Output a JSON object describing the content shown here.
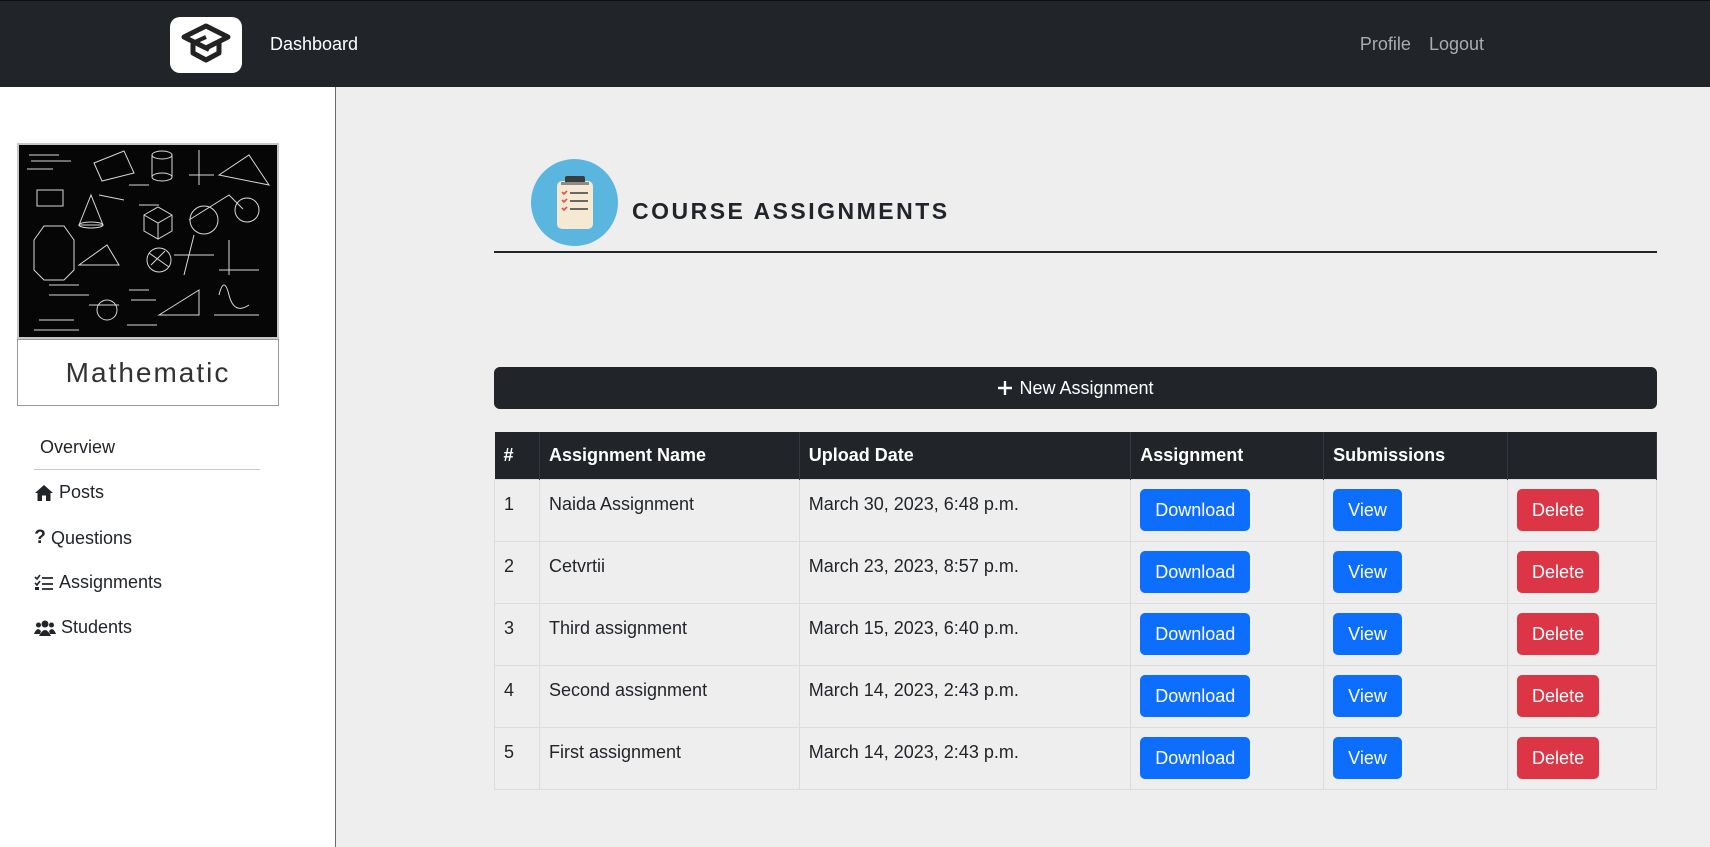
{
  "navbar": {
    "brand_link": "Dashboard",
    "profile_link": "Profile",
    "logout_link": "Logout"
  },
  "sidebar": {
    "course_name": "Mathematic",
    "overview_label": "Overview",
    "items": [
      {
        "label": "Posts",
        "icon": "house-icon"
      },
      {
        "label": "Questions",
        "icon": "question-mark-icon"
      },
      {
        "label": "Assignments",
        "icon": "checklist-icon"
      },
      {
        "label": "Students",
        "icon": "users-icon"
      }
    ]
  },
  "main": {
    "title": "COURSE ASSIGNMENTS",
    "header_icon": "clipboard-icon",
    "new_button_label": "New Assignment",
    "table": {
      "headers": [
        "#",
        "Assignment Name",
        "Upload Date",
        "Assignment",
        "Submissions",
        ""
      ],
      "rows": [
        {
          "num": "1",
          "name": "Naida Assignment",
          "date": "March 30, 2023, 6:48 p.m.",
          "download": "Download",
          "view": "View",
          "delete": "Delete"
        },
        {
          "num": "2",
          "name": "Cetvrtii",
          "date": "March 23, 2023, 8:57 p.m.",
          "download": "Download",
          "view": "View",
          "delete": "Delete"
        },
        {
          "num": "3",
          "name": "Third assignment",
          "date": "March 15, 2023, 6:40 p.m.",
          "download": "Download",
          "view": "View",
          "delete": "Delete"
        },
        {
          "num": "4",
          "name": "Second assignment",
          "date": "March 14, 2023, 2:43 p.m.",
          "download": "Download",
          "view": "View",
          "delete": "Delete"
        },
        {
          "num": "5",
          "name": "First assignment",
          "date": "March 14, 2023, 2:43 p.m.",
          "download": "Download",
          "view": "View",
          "delete": "Delete"
        }
      ]
    }
  },
  "colors": {
    "navbar": "#212529",
    "primary": "#0d6efd",
    "danger": "#dc3545",
    "header_circle": "#5ab6de",
    "content_bg": "#efeeef"
  }
}
